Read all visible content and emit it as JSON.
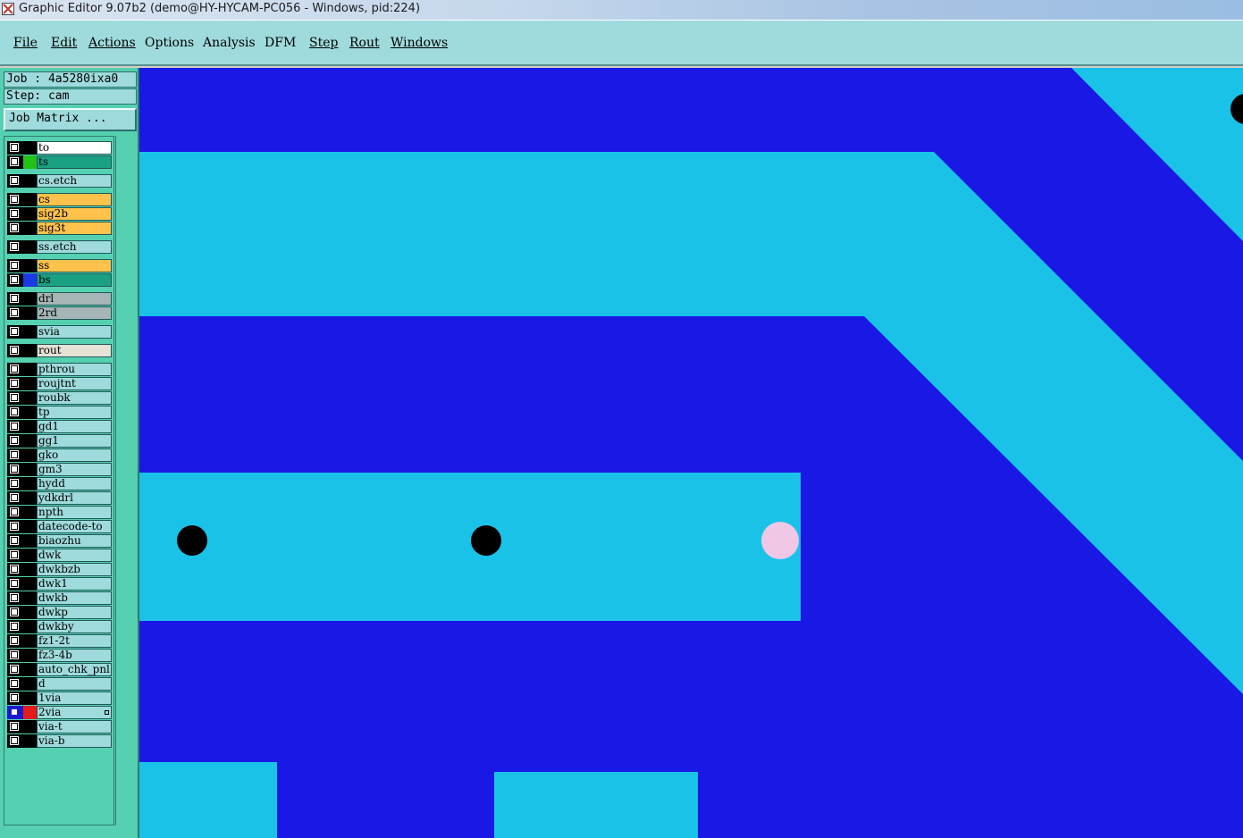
{
  "window": {
    "title": "Graphic Editor 9.07b2 (demo@HY-HYCAM-PC056 - Windows, pid:224)"
  },
  "menu": [
    "File",
    "Edit",
    "Actions",
    "Options",
    "Analysis",
    "DFM",
    "Step",
    "Rout",
    "Windows"
  ],
  "info": {
    "job": "Job : 4a5280ixa0",
    "step": "Step: cam",
    "job_matrix": "Job Matrix ..."
  },
  "layers": [
    {
      "name": "to",
      "color": "#ffffff",
      "swatch": "#000000"
    },
    {
      "name": "ts",
      "color": "#1aa183",
      "swatch": "#22c21a"
    },
    {
      "name": "cs.etch",
      "color": "#9fdbdc",
      "swatch": "#000000"
    },
    {
      "name": "cs",
      "color": "#ffc24a",
      "swatch": "#000000"
    },
    {
      "name": "sig2b",
      "color": "#ffc24a",
      "swatch": "#000000"
    },
    {
      "name": "sig3t",
      "color": "#ffc24a",
      "swatch": "#000000"
    },
    {
      "name": "ss.etch",
      "color": "#9fdbdc",
      "swatch": "#000000"
    },
    {
      "name": "ss",
      "color": "#ffc24a",
      "swatch": "#000000"
    },
    {
      "name": "bs",
      "color": "#1aa183",
      "swatch": "#1a3ae5"
    },
    {
      "name": "drl",
      "color": "#a6b5b5",
      "swatch": "#000000"
    },
    {
      "name": "2rd",
      "color": "#a6b5b5",
      "swatch": "#000000"
    },
    {
      "name": "svia",
      "color": "#9fdbdc",
      "swatch": "#000000"
    },
    {
      "name": "rout",
      "color": "#e6e2d6",
      "swatch": "#000000"
    },
    {
      "name": "pthrou",
      "color": "#9fdbdc",
      "swatch": "#000000"
    },
    {
      "name": "roujtnt",
      "color": "#9fdbdc",
      "swatch": "#000000"
    },
    {
      "name": "roubk",
      "color": "#9fdbdc",
      "swatch": "#000000"
    },
    {
      "name": "tp",
      "color": "#9fdbdc",
      "swatch": "#000000"
    },
    {
      "name": "gd1",
      "color": "#9fdbdc",
      "swatch": "#000000"
    },
    {
      "name": "gg1",
      "color": "#9fdbdc",
      "swatch": "#000000"
    },
    {
      "name": "gko",
      "color": "#9fdbdc",
      "swatch": "#000000"
    },
    {
      "name": "gm3",
      "color": "#9fdbdc",
      "swatch": "#000000"
    },
    {
      "name": "hydd",
      "color": "#9fdbdc",
      "swatch": "#000000"
    },
    {
      "name": "ydkdrl",
      "color": "#9fdbdc",
      "swatch": "#000000"
    },
    {
      "name": "npth",
      "color": "#9fdbdc",
      "swatch": "#000000"
    },
    {
      "name": "datecode-to",
      "color": "#9fdbdc",
      "swatch": "#000000"
    },
    {
      "name": "biaozhu",
      "color": "#9fdbdc",
      "swatch": "#000000"
    },
    {
      "name": "dwk",
      "color": "#9fdbdc",
      "swatch": "#000000"
    },
    {
      "name": "dwkbzb",
      "color": "#9fdbdc",
      "swatch": "#000000"
    },
    {
      "name": "dwk1",
      "color": "#9fdbdc",
      "swatch": "#000000"
    },
    {
      "name": "dwkb",
      "color": "#9fdbdc",
      "swatch": "#000000"
    },
    {
      "name": "dwkp",
      "color": "#9fdbdc",
      "swatch": "#000000"
    },
    {
      "name": "dwkby",
      "color": "#9fdbdc",
      "swatch": "#000000"
    },
    {
      "name": "fz1-2t",
      "color": "#9fdbdc",
      "swatch": "#000000"
    },
    {
      "name": "fz3-4b",
      "color": "#9fdbdc",
      "swatch": "#000000"
    },
    {
      "name": "auto_chk_pnl",
      "color": "#9fdbdc",
      "swatch": "#000000"
    },
    {
      "name": "d",
      "color": "#9fdbdc",
      "swatch": "#000000"
    },
    {
      "name": "1via",
      "color": "#9fdbdc",
      "swatch": "#000000"
    },
    {
      "name": "2via",
      "color": "#9fdbdc",
      "swatch": "#e51a1a",
      "selected": true
    },
    {
      "name": "via-t",
      "color": "#9fdbdc",
      "swatch": "#000000"
    },
    {
      "name": "via-b",
      "color": "#9fdbdc",
      "swatch": "#000000"
    }
  ],
  "canvas_colors": {
    "background": "#1a18e5",
    "copper": "#1ac2e8",
    "hole": "#000000",
    "highlight": "#f0c8e6"
  }
}
